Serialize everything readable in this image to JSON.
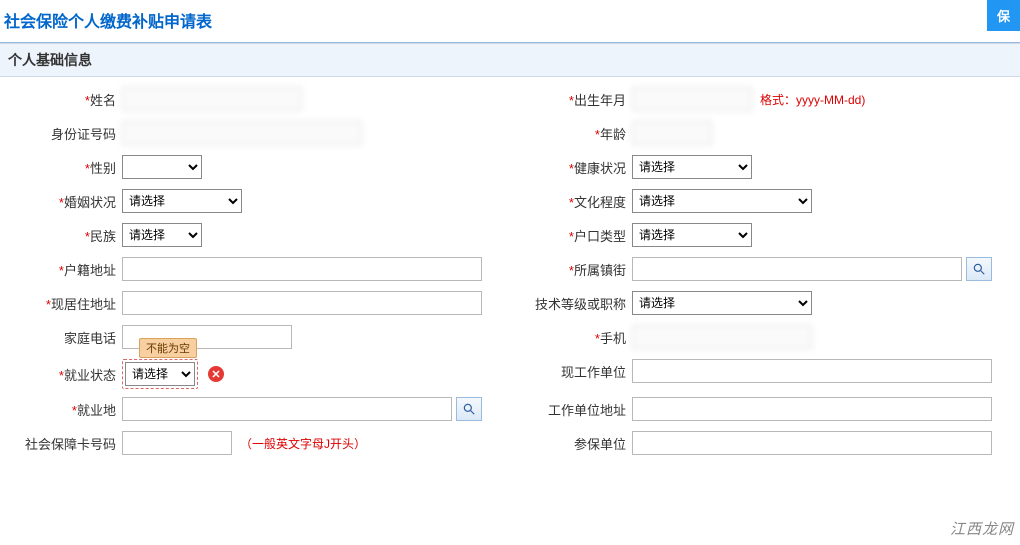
{
  "page_title": "社会保险个人缴费补贴申请表",
  "top_button": "保",
  "section_title": "个人基础信息",
  "placeholder_select": "请选择",
  "error_tip": "不能为空",
  "fields": {
    "name": {
      "label": "姓名",
      "required": true,
      "value": ""
    },
    "dob": {
      "label": "出生年月",
      "required": true,
      "value": "",
      "hint": "格式：yyyy-MM-dd)"
    },
    "idno": {
      "label": "身份证号码",
      "required": false,
      "value": ""
    },
    "age": {
      "label": "年龄",
      "required": true,
      "value": ""
    },
    "gender": {
      "label": "性别",
      "required": true,
      "value": ""
    },
    "health": {
      "label": "健康状况",
      "required": true,
      "value": "请选择"
    },
    "marital": {
      "label": "婚姻状况",
      "required": true,
      "value": "请选择"
    },
    "edu": {
      "label": "文化程度",
      "required": true,
      "value": "请选择"
    },
    "ethnic": {
      "label": "民族",
      "required": true,
      "value": "请选择"
    },
    "hukou": {
      "label": "户口类型",
      "required": true,
      "value": "请选择"
    },
    "huji_addr": {
      "label": "户籍地址",
      "required": true,
      "value": ""
    },
    "town": {
      "label": "所属镇街",
      "required": true,
      "value": ""
    },
    "live_addr": {
      "label": "现居住地址",
      "required": true,
      "value": ""
    },
    "skill": {
      "label": "技术等级或职称",
      "required": false,
      "value": "请选择"
    },
    "home_tel": {
      "label": "家庭电话",
      "required": false,
      "value": ""
    },
    "mobile": {
      "label": "手机",
      "required": true,
      "value": ""
    },
    "emp_status": {
      "label": "就业状态",
      "required": true,
      "value": "请选择"
    },
    "cur_unit": {
      "label": "现工作单位",
      "required": false,
      "value": ""
    },
    "emp_place": {
      "label": "就业地",
      "required": true,
      "value": ""
    },
    "unit_addr": {
      "label": "工作单位地址",
      "required": false,
      "value": ""
    },
    "sscard": {
      "label": "社会保障卡号码",
      "required": false,
      "value": "",
      "hint": "（一般英文字母J开头）"
    },
    "insure_unit": {
      "label": "参保单位",
      "required": false,
      "value": ""
    }
  },
  "watermark": "江西龙网"
}
